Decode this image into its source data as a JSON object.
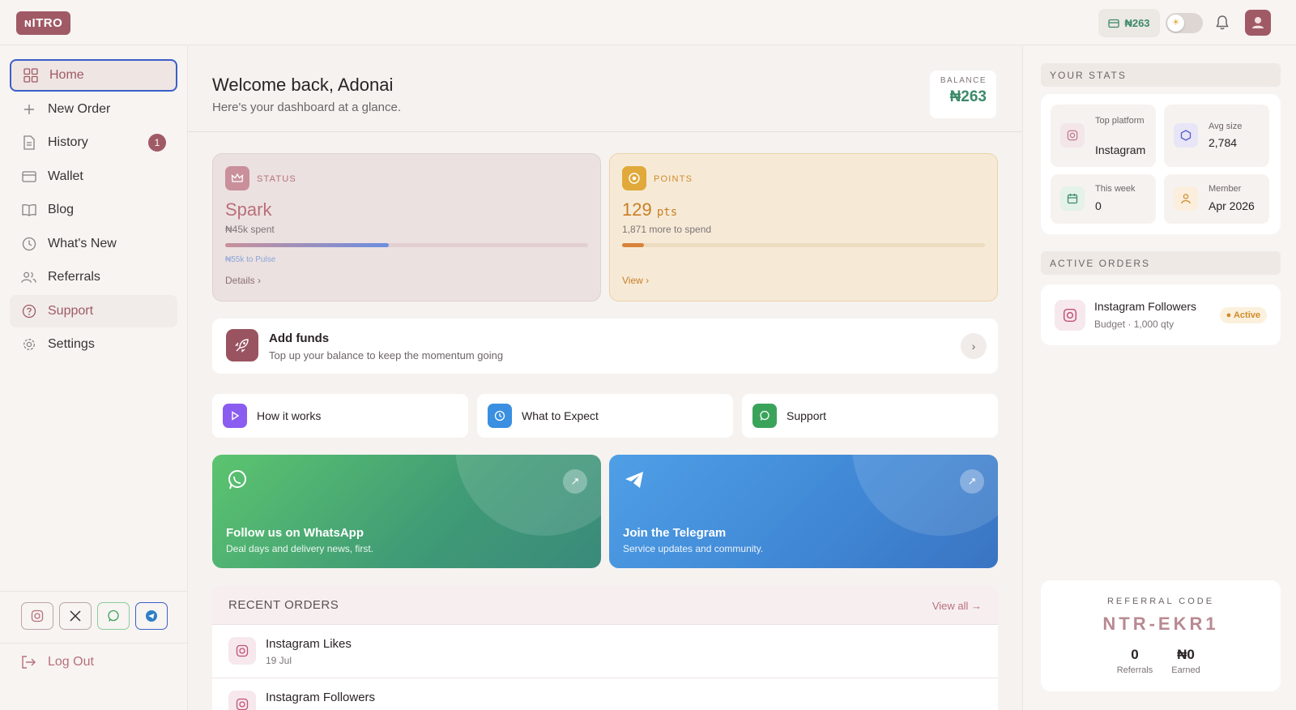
{
  "topbar": {
    "logo": "ɴITRO",
    "balance_chip": "₦263"
  },
  "sidebar": {
    "items": [
      {
        "label": "Home"
      },
      {
        "label": "New Order"
      },
      {
        "label": "History",
        "badge": "1"
      },
      {
        "label": "Wallet"
      },
      {
        "label": "Blog"
      },
      {
        "label": "What's New"
      },
      {
        "label": "Referrals"
      },
      {
        "label": "Support"
      },
      {
        "label": "Settings"
      }
    ],
    "logout": "Log Out"
  },
  "main": {
    "welcome": "Welcome back, Adonai",
    "subtitle": "Here's your dashboard at a glance.",
    "balance": {
      "label": "BALANCE",
      "value": "₦263"
    },
    "status_card": {
      "kicker": "STATUS",
      "tier": "Spark",
      "spent": "₦45k spent",
      "progress": 0.45,
      "note": "₦55k to Pulse",
      "link": "Details"
    },
    "points_card": {
      "kicker": "POINTS",
      "points": "129",
      "unit": "pts",
      "more": "1,871 more to spend",
      "progress": 0.06,
      "link": "View"
    },
    "add_funds": {
      "title": "Add funds",
      "subtitle": "Top up your balance to keep the momentum going"
    },
    "quick_links": [
      {
        "label": "How it works"
      },
      {
        "label": "What to Expect"
      },
      {
        "label": "Support"
      }
    ],
    "promos": [
      {
        "title": "Follow us on WhatsApp",
        "subtitle": "Deal days and delivery news, first."
      },
      {
        "title": "Join the Telegram",
        "subtitle": "Service updates and community."
      }
    ],
    "recent_orders": {
      "title": "RECENT ORDERS",
      "view_all": "View all →",
      "rows": [
        {
          "name": "Instagram Likes",
          "date": "19 Jul"
        },
        {
          "name": "Instagram Followers",
          "date": ""
        }
      ]
    }
  },
  "right": {
    "stats_title": "YOUR STATS",
    "stats": [
      {
        "label": "Top platform",
        "value": "Instagram"
      },
      {
        "label": "Avg size",
        "value": "2,784"
      },
      {
        "label": "This week",
        "value": "0"
      },
      {
        "label": "Member",
        "value": "Apr 2026"
      }
    ],
    "active_title": "ACTIVE ORDERS",
    "active_order": {
      "name": "Instagram Followers",
      "meta": "Budget · 1,000 qty",
      "status": "Active"
    },
    "referral": {
      "label": "REFERRAL CODE",
      "code": "NTR-EKR1",
      "referrals_value": "0",
      "referrals_label": "Referrals",
      "earned_value": "₦0",
      "earned_label": "Earned"
    }
  },
  "colors": {
    "accent": "#a05a65",
    "green": "#3d8a6b",
    "focus": "#3a5fc8"
  }
}
